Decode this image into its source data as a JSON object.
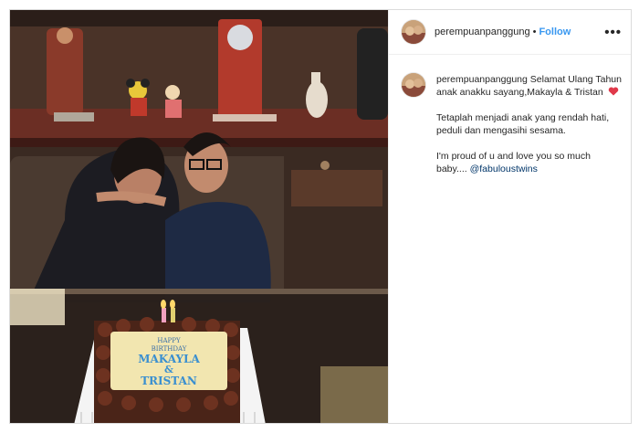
{
  "post": {
    "username": "perempuanpanggung",
    "separator": "•",
    "follow_label": "Follow",
    "more_label": "•••",
    "caption": {
      "username": "perempuanpanggung",
      "line1": "Selamat Ulang Tahun anak anakku sayang,Makayla & Tristan",
      "heart_icon": "heart-emoji",
      "paragraph2": "Tetaplah menjadi anak yang rendah hati, peduli dan mengasihi sesama.",
      "paragraph3": "I'm proud of u and love you so much baby....",
      "mention": "@fabuloustwins"
    }
  },
  "photo": {
    "cake_text": [
      "HAPPY",
      "BIRTHDAY",
      "MAKAYLA",
      "&",
      "TRISTAN"
    ]
  },
  "colors": {
    "link": "#3897f0",
    "mention": "#003569",
    "text": "#262626"
  }
}
